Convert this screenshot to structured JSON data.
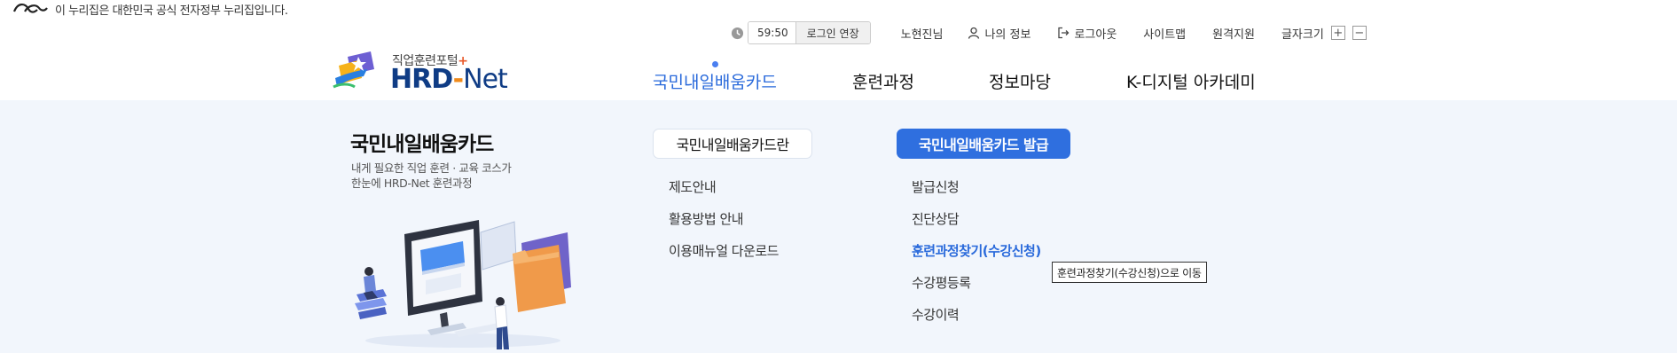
{
  "gov_banner": {
    "text": "이 누리집은 대한민국 공식 전자정부 누리집입니다."
  },
  "util": {
    "timer": "59:50",
    "extend_label": "로그인 연장",
    "user_name": "노현진님",
    "my_info": "나의 정보",
    "logout": "로그아웃",
    "sitemap": "사이트맵",
    "remote_support": "원격지원",
    "font_size": "글자크기",
    "font_plus": "+",
    "font_minus": "−"
  },
  "logo": {
    "sub": "직업훈련포털",
    "plus": "+",
    "main_hrd": "HRD",
    "dash": "-",
    "main_net": "Net"
  },
  "gnb": {
    "items": [
      "국민내일배움카드",
      "훈련과정",
      "정보마당",
      "K-디지털 아카데미"
    ],
    "active_index": 0
  },
  "panel": {
    "title": "국민내일배움카드",
    "desc_line1": "내게 필요한 직업 훈련 · 교육 코스가",
    "desc_line2": "한눈에 HRD-Net 훈련과정",
    "col1": {
      "button": "국민내일배움카드란",
      "links": [
        "제도안내",
        "활용방법 안내",
        "이용매뉴얼 다운로드"
      ]
    },
    "col2": {
      "button": "국민내일배움카드 발급",
      "links": [
        "발급신청",
        "진단상담",
        "훈련과정찾기(수강신청)",
        "수강평등록",
        "수강이력"
      ],
      "hover_index": 2
    },
    "tooltip": "훈련과정찾기(수강신청)으로 이동"
  },
  "colors": {
    "accent": "#2f6fdf",
    "panel_bg": "#f2f6fc",
    "active_nav": "#2a6adb",
    "brand_navy": "#0f3c85",
    "brand_orange": "#f08a1a"
  }
}
